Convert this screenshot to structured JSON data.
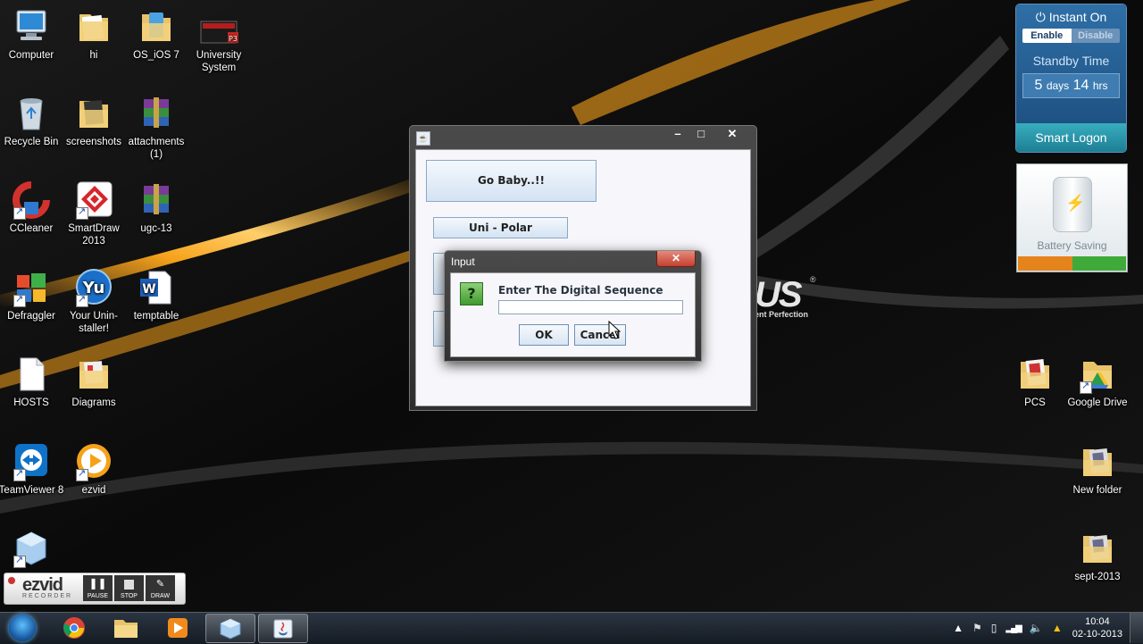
{
  "desktop_icons": [
    {
      "name": "computer",
      "label": "Computer"
    },
    {
      "name": "hi",
      "label": "hi"
    },
    {
      "name": "os-ios7",
      "label": "OS_iOS 7"
    },
    {
      "name": "university-system",
      "label": "University System"
    },
    {
      "name": "recycle-bin",
      "label": "Recycle Bin"
    },
    {
      "name": "screenshots",
      "label": "screenshots"
    },
    {
      "name": "attachments",
      "label": "attachments (1)"
    },
    {
      "name": "ccleaner",
      "label": "CCleaner"
    },
    {
      "name": "smartdraw",
      "label": "SmartDraw 2013"
    },
    {
      "name": "ugc-13",
      "label": "ugc-13"
    },
    {
      "name": "defraggler",
      "label": "Defraggler"
    },
    {
      "name": "your-uninstaller",
      "label": "Your Unin-staller!"
    },
    {
      "name": "temptable",
      "label": "temptable"
    },
    {
      "name": "hosts",
      "label": "HOSTS"
    },
    {
      "name": "diagrams",
      "label": "Diagrams"
    },
    {
      "name": "teamviewer",
      "label": "TeamViewer 8"
    },
    {
      "name": "ezvid",
      "label": "ezvid"
    },
    {
      "name": "pcs",
      "label": "PCS"
    },
    {
      "name": "google-drive",
      "label": "Google Drive"
    },
    {
      "name": "new-folder",
      "label": "New folder"
    },
    {
      "name": "sept-2013",
      "label": "sept-2013"
    }
  ],
  "gadget": {
    "title": "Instant On",
    "enable": "Enable",
    "disable": "Disable",
    "standby_label": "Standby Time",
    "days_value": "5",
    "days_unit": "days",
    "hrs_value": "14",
    "hrs_unit": "hrs",
    "logon": "Smart Logon"
  },
  "battery": {
    "label": "Battery Saving",
    "left_color": "#e5831d",
    "right_color": "#3faa3a"
  },
  "wallpaper": {
    "brand_text": "US",
    "tagline": "ent Perfection",
    "reg": "®",
    "stripe_color": "#f5a21a"
  },
  "java_frame": {
    "buttons": {
      "go": "Go Baby..!!",
      "unipolar": "Uni - Polar"
    },
    "minimize": "–",
    "maximize": "□",
    "close": "✕"
  },
  "dialog": {
    "title": "Input",
    "prompt": "Enter The Digital Sequence",
    "input_value": "",
    "ok": "OK",
    "cancel": "Cancel",
    "close": "✕",
    "question_glyph": "?"
  },
  "ezvid_widget": {
    "logo": "ezvid",
    "sub": "RECORDER",
    "pause": "PAUSE",
    "stop": "STOP",
    "draw": "DRAW"
  },
  "taskbar": {
    "items": [
      "chrome",
      "explorer",
      "media-player",
      "virtualbox",
      "java"
    ],
    "clock_time": "10:04",
    "clock_date": "02-10-2013"
  }
}
